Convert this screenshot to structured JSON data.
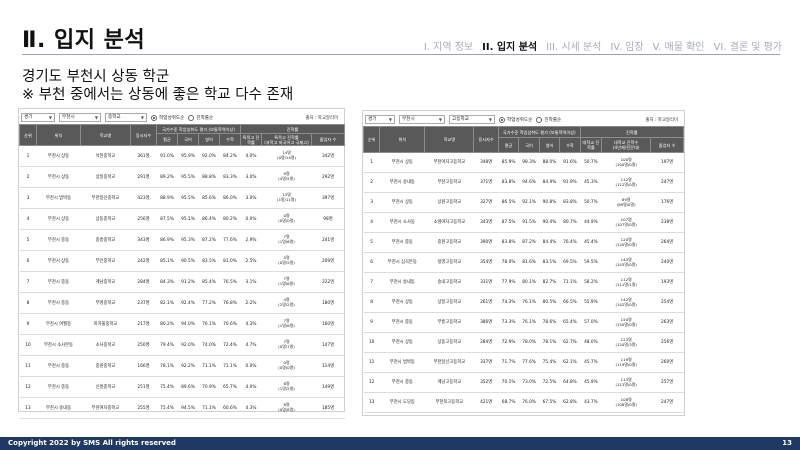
{
  "title": "Ⅱ. 입지 분석",
  "nav": [
    {
      "label": "I. 지역 정보",
      "active": false
    },
    {
      "label": "II. 입지 분석",
      "active": true
    },
    {
      "label": "III. 시세 분석",
      "active": false
    },
    {
      "label": "IV. 임장",
      "active": false
    },
    {
      "label": "V. 매물 확인",
      "active": false
    },
    {
      "label": "VI. 결론 및 평가",
      "active": false
    }
  ],
  "headline": {
    "line1": "경기도 부천시 상동 학군",
    "line2": "※ 부천 중에서는 상동에 좋은 학교 다수 존재"
  },
  "left_panel": {
    "filters": {
      "region": "경기",
      "city": "부천시",
      "school_type": "중학교"
    },
    "radio_selected": "학업성취도순",
    "radio_other": "진학률순",
    "source": "출처 : 학교알리미",
    "headers": {
      "rank": "순위",
      "location": "위치",
      "school": "학교명",
      "students": "응시자수",
      "group": "국가수준 학업성취도 평가 (보통학력이상)",
      "avg": "평균",
      "kor": "국어",
      "eng": "영어",
      "math": "수학",
      "special_group": "진학률",
      "special": "특목고 진학률",
      "special_sub": "(과학고 외국어고 국제고)",
      "ratio": "졸업자 수"
    },
    "rows": [
      {
        "rank": "1",
        "loc": "부천시 상동",
        "name": "석천중학교",
        "n": "361명",
        "avg": "91.0%",
        "kor": "95.9%",
        "eng": "92.0%",
        "math": "84.2%",
        "sp": "4.0%",
        "cnt1": "14명",
        "cnt2": "(0명/14명)",
        "grad": "342명"
      },
      {
        "rank": "2",
        "loc": "부천시 상동",
        "name": "상일중학교",
        "n": "291명",
        "avg": "89.2%",
        "kor": "95.5%",
        "eng": "88.8%",
        "math": "83.3%",
        "sp": "3.0%",
        "cnt1": "9명",
        "cnt2": "(4명/5명)",
        "grad": "292명"
      },
      {
        "rank": "3",
        "loc": "부천시 범박동",
        "name": "부천일신중학교",
        "n": "423명",
        "avg": "88.9%",
        "kor": "95.5%",
        "eng": "85.6%",
        "math": "86.0%",
        "sp": "3.0%",
        "cnt1": "13명",
        "cnt2": "(1명/11명)",
        "grad": "397명"
      },
      {
        "rank": "4",
        "loc": "부천시 상동",
        "name": "상동중학교",
        "n": "256명",
        "avg": "87.5%",
        "kor": "95.1%",
        "eng": "86.4%",
        "math": "80.2%",
        "sp": "0.0%",
        "cnt1": "0명",
        "cnt2": "(0명/0명)",
        "grad": "98명"
      },
      {
        "rank": "5",
        "loc": "부천시 중동",
        "name": "중흥중학교",
        "n": "343명",
        "avg": "86.9%",
        "kor": "95.3%",
        "eng": "87.2%",
        "math": "77.6%",
        "sp": "2.9%",
        "cnt1": "7명",
        "cnt2": "(1명/6명)",
        "grad": "241명"
      },
      {
        "rank": "6",
        "loc": "부천시 상동",
        "name": "부인중학교",
        "n": "242명",
        "avg": "85.1%",
        "kor": "90.5%",
        "eng": "83.5%",
        "math": "81.0%",
        "sp": "2.5%",
        "cnt1": "5명",
        "cnt2": "(0명/5명)",
        "grad": "209명"
      },
      {
        "rank": "7",
        "loc": "부천시 중동",
        "name": "계남중학교",
        "n": "284명",
        "avg": "84.3%",
        "kor": "91.2%",
        "eng": "85.4%",
        "math": "76.5%",
        "sp": "3.1%",
        "cnt1": "7명",
        "cnt2": "(1명/6명)",
        "grad": "222명"
      },
      {
        "rank": "8",
        "loc": "부천시 중동",
        "name": "부명중학교",
        "n": "237명",
        "avg": "82.1%",
        "kor": "92.4%",
        "eng": "77.2%",
        "math": "76.8%",
        "sp": "2.2%",
        "cnt1": "4명",
        "cnt2": "(2명/2명)",
        "grad": "180명"
      },
      {
        "rank": "9",
        "loc": "부천시 여월동",
        "name": "까치울중학교",
        "n": "217명",
        "avg": "80.2%",
        "kor": "94.0%",
        "eng": "76.1%",
        "math": "70.6%",
        "sp": "4.3%",
        "cnt1": "7명",
        "cnt2": "(1명/6명)",
        "grad": "160명"
      },
      {
        "rank": "10",
        "loc": "부천시 소사본동",
        "name": "소사중학교",
        "n": "250명",
        "avg": "79.4%",
        "kor": "92.0%",
        "eng": "74.0%",
        "math": "72.4%",
        "sp": "4.7%",
        "cnt1": "7명",
        "cnt2": "(0명/7명)",
        "grad": "147명"
      },
      {
        "rank": "11",
        "loc": "부천시 중동",
        "name": "중원중학교",
        "n": "166명",
        "avg": "78.1%",
        "kor": "92.2%",
        "eng": "71.1%",
        "math": "71.1%",
        "sp": "0.0%",
        "cnt1": "0명",
        "cnt2": "(0명/0명)",
        "grad": "114명"
      },
      {
        "rank": "12",
        "loc": "부천시 중동",
        "name": "신흥중학교",
        "n": "251명",
        "avg": "75.4%",
        "kor": "89.6%",
        "eng": "70.9%",
        "math": "65.7%",
        "sp": "4.0%",
        "cnt1": "6명",
        "cnt2": "(1명/5명)",
        "grad": "149명"
      },
      {
        "rank": "13",
        "loc": "부천시 송내동",
        "name": "부천여자중학교",
        "n": "255명",
        "avg": "75.4%",
        "kor": "94.5%",
        "eng": "71.1%",
        "math": "60.6%",
        "sp": "4.3%",
        "cnt1": "8명",
        "cnt2": "(0명/8명)",
        "grad": "185명"
      }
    ]
  },
  "right_panel": {
    "filters": {
      "region": "경기",
      "city": "부천시",
      "school_type": "고등학교"
    },
    "radio_selected": "학업성취도순",
    "radio_other": "진학률순",
    "source": "출처 : 학교알리미",
    "headers": {
      "rank": "순위",
      "location": "위치",
      "school": "학교명",
      "students": "응시자수",
      "group": "국가수준 학업성취도 평가 (보통학력이상)",
      "avg": "평균",
      "kor": "국어",
      "eng": "영어",
      "math": "수학",
      "special_group": "진학률",
      "univ": "대학교 진학률",
      "major": "대학교 진학수",
      "major_sub": "(4년제/전문대)",
      "grad": "졸업자 수"
    },
    "rows": [
      {
        "rank": "1",
        "loc": "부천시 상동",
        "name": "부천여자고등학교",
        "n": "348명",
        "avg": "85.9%",
        "kor": "98.3%",
        "eng": "88.0%",
        "math": "91.6%",
        "univ": "50.7%",
        "cnt1": "100명",
        "cnt2": "(100명/0명)",
        "grad": "197명"
      },
      {
        "rank": "2",
        "loc": "부천시 송내동",
        "name": "부천고등학교",
        "n": "371명",
        "avg": "83.8%",
        "kor": "94.6%",
        "eng": "84.9%",
        "math": "91.9%",
        "univ": "45.3%",
        "cnt1": "112명",
        "cnt2": "(112명/0명)",
        "grad": "247명"
      },
      {
        "rank": "3",
        "loc": "부천시 상동",
        "name": "상원고등학교",
        "n": "327명",
        "avg": "86.5%",
        "kor": "92.1%",
        "eng": "90.8%",
        "math": "83.8%",
        "univ": "50.7%",
        "cnt1": "89명",
        "cnt2": "(89명/0명)",
        "grad": "176명"
      },
      {
        "rank": "4",
        "loc": "부천시 소사동",
        "name": "소명여자고등학교",
        "n": "343명",
        "avg": "87.5%",
        "kor": "91.5%",
        "eng": "90.4%",
        "math": "80.7%",
        "univ": "44.9%",
        "cnt1": "107명",
        "cnt2": "(107명/0명)",
        "grad": "238명"
      },
      {
        "rank": "5",
        "loc": "부천시 중동",
        "name": "중원고등학교",
        "n": "390명",
        "avg": "83.8%",
        "kor": "87.2%",
        "eng": "84.4%",
        "math": "76.4%",
        "univ": "45.4%",
        "cnt1": "120명",
        "cnt2": "(120명/0명)",
        "grad": "264명"
      },
      {
        "rank": "6",
        "loc": "부천시 심곡본동",
        "name": "정명고등학교",
        "n": "354명",
        "avg": "78.0%",
        "kor": "81.6%",
        "eng": "83.1%",
        "math": "69.5%",
        "univ": "59.5%",
        "cnt1": "143명",
        "cnt2": "(143명/0명)",
        "grad": "240명"
      },
      {
        "rank": "7",
        "loc": "부천시 송내동",
        "name": "송내고등학교",
        "n": "331명",
        "avg": "77.9%",
        "kor": "80.1%",
        "eng": "82.7%",
        "math": "71.1%",
        "univ": "58.2%",
        "cnt1": "112명",
        "cnt2": "(111명/1명)",
        "grad": "193명"
      },
      {
        "rank": "8",
        "loc": "부천시 상동",
        "name": "상일고등학교",
        "n": "261명",
        "avg": "74.3%",
        "kor": "76.1%",
        "eng": "80.5%",
        "math": "66.5%",
        "univ": "55.9%",
        "cnt1": "142명",
        "cnt2": "(142명/0명)",
        "grad": "254명"
      },
      {
        "rank": "9",
        "loc": "부천시 중동",
        "name": "부흥고등학교",
        "n": "386명",
        "avg": "73.3%",
        "kor": "76.1%",
        "eng": "78.6%",
        "math": "65.4%",
        "univ": "57.0%",
        "cnt1": "150명",
        "cnt2": "(150명/0명)",
        "grad": "263명"
      },
      {
        "rank": "10",
        "loc": "부천시 상동",
        "name": "상동고등학교",
        "n": "284명",
        "avg": "72.9%",
        "kor": "78.0%",
        "eng": "78.1%",
        "math": "62.7%",
        "univ": "48.0%",
        "cnt1": "123명",
        "cnt2": "(120명/3명)",
        "grad": "256명"
      },
      {
        "rank": "11",
        "loc": "부천시 범박동",
        "name": "부천일신고등학교",
        "n": "337명",
        "avg": "71.7%",
        "kor": "77.6%",
        "eng": "75.4%",
        "math": "62.1%",
        "univ": "45.7%",
        "cnt1": "119명",
        "cnt2": "(119명/0명)",
        "grad": "260명"
      },
      {
        "rank": "12",
        "loc": "부천시 중동",
        "name": "계남고등학교",
        "n": "352명",
        "avg": "70.1%",
        "kor": "73.0%",
        "eng": "72.5%",
        "math": "64.8%",
        "univ": "45.9%",
        "cnt1": "113명",
        "cnt2": "(113명/0명)",
        "grad": "257명"
      },
      {
        "rank": "13",
        "loc": "부천시 도당동",
        "name": "부천북고등학교",
        "n": "421명",
        "avg": "68.7%",
        "kor": "76.0%",
        "eng": "67.5%",
        "math": "62.8%",
        "univ": "43.7%",
        "cnt1": "108명",
        "cnt2": "(108명/0명)",
        "grad": "247명"
      }
    ]
  },
  "footer": {
    "copyright": "Copyright 2022 by SMS All rights reserved",
    "page": "13"
  }
}
